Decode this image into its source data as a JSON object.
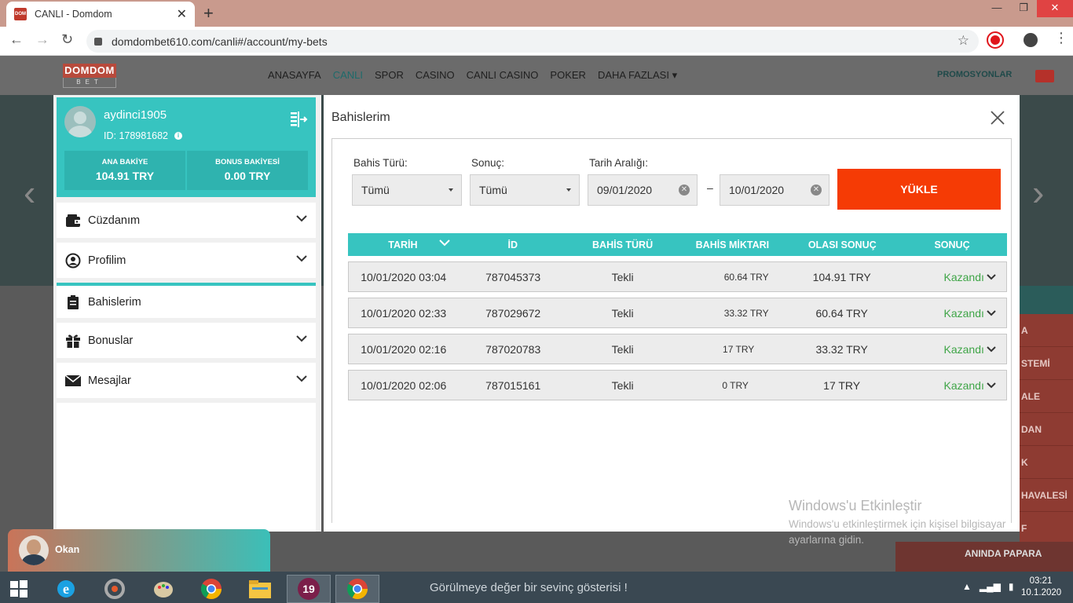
{
  "browser": {
    "tab_title": "CANLI - Domdom",
    "favicon_text": "DOM",
    "url": "domdombet610.com/canli#/account/my-bets"
  },
  "site": {
    "logo_top": "DOMDOM",
    "logo_bottom": "BET",
    "nav": [
      "ANASAYFA",
      "CANLI",
      "SPOR",
      "CASINO",
      "CANLI CASINO",
      "POKER",
      "DAHA FAZLASI"
    ],
    "promo": "PROMOSYONLAR",
    "right_menu": [
      "A",
      "STEMİ",
      "ALE",
      "DAN",
      "K",
      "HAVALESİ",
      "F"
    ],
    "papara": "ANINDA PAPARA"
  },
  "account": {
    "username": "aydinci1905",
    "user_id": "ID: 178981682",
    "main_balance_label": "ANA BAKİYE",
    "main_balance": "104.91 TRY",
    "bonus_balance_label": "BONUS BAKİYESİ",
    "bonus_balance": "0.00 TRY",
    "menu": [
      {
        "label": "Cüzdanım",
        "icon": "wallet-icon"
      },
      {
        "label": "Profilim",
        "icon": "profile-icon"
      },
      {
        "label": "Bahislerim",
        "icon": "clipboard-icon"
      },
      {
        "label": "Bonuslar",
        "icon": "gift-icon"
      },
      {
        "label": "Mesajlar",
        "icon": "envelope-icon"
      }
    ]
  },
  "bets": {
    "title": "Bahislerim",
    "filters": {
      "bet_type_label": "Bahis Türü:",
      "bet_type_value": "Tümü",
      "result_label": "Sonuç:",
      "result_value": "Tümü",
      "date_range_label": "Tarih Aralığı:",
      "date_from": "09/01/2020",
      "date_to": "10/01/2020",
      "dash": "–",
      "load_button": "YÜKLE"
    },
    "columns": [
      "TARİH",
      "İD",
      "BAHİS TÜRÜ",
      "BAHİS MİKTARI",
      "OLASI SONUÇ",
      "SONUÇ"
    ],
    "rows": [
      {
        "date": "10/01/2020 03:04",
        "id": "787045373",
        "type": "Tekli",
        "amount": "60.64 TRY",
        "possible": "104.91 TRY",
        "result": "Kazandı"
      },
      {
        "date": "10/01/2020 02:33",
        "id": "787029672",
        "type": "Tekli",
        "amount": "33.32 TRY",
        "possible": "60.64 TRY",
        "result": "Kazandı"
      },
      {
        "date": "10/01/2020 02:16",
        "id": "787020783",
        "type": "Tekli",
        "amount": "17 TRY",
        "possible": "33.32 TRY",
        "result": "Kazandı"
      },
      {
        "date": "10/01/2020 02:06",
        "id": "787015161",
        "type": "Tekli",
        "amount": "0 TRY",
        "possible": "17 TRY",
        "result": "Kazandı"
      }
    ]
  },
  "watermark": {
    "title": "Windows'u Etkinleştir",
    "subtitle": "Windows'u etkinleştirmek için kişisel bilgisayar ayarlarına gidin."
  },
  "chat": {
    "agent_name": "Okan"
  },
  "taskbar": {
    "ticker": "Görülmeye değer bir sevinç gösterisi !",
    "time": "03:21",
    "date": "10.1.2020",
    "badge": "19"
  },
  "colors": {
    "teal": "#37c4c0",
    "load_button": "#f53b05",
    "won": "#3fa547"
  }
}
